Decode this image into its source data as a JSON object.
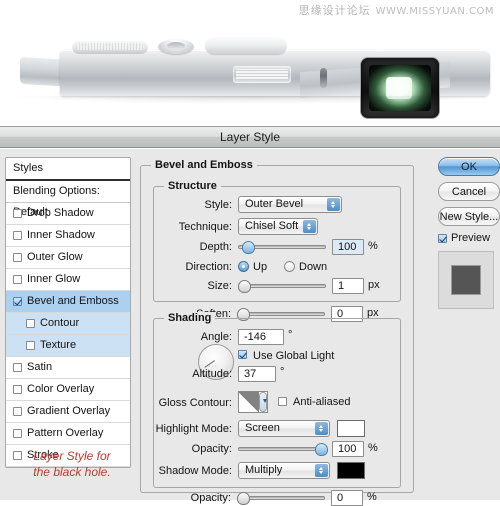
{
  "watermark": {
    "cn": "思缘设计论坛",
    "url": "WWW.MISSYUAN.COM"
  },
  "photo": {
    "alt": "silver compact camera side view with black lens window"
  },
  "dialog": {
    "title": "Layer Style"
  },
  "sidebar": {
    "header": "Styles",
    "blending_options": "Blending Options: Default",
    "items": [
      {
        "label": "Drop Shadow",
        "checked": false,
        "selected": false,
        "sub": false
      },
      {
        "label": "Inner Shadow",
        "checked": false,
        "selected": false,
        "sub": false
      },
      {
        "label": "Outer Glow",
        "checked": false,
        "selected": false,
        "sub": false
      },
      {
        "label": "Inner Glow",
        "checked": false,
        "selected": false,
        "sub": false
      },
      {
        "label": "Bevel and Emboss",
        "checked": true,
        "selected": true,
        "sub": false
      },
      {
        "label": "Contour",
        "checked": false,
        "selected": false,
        "sub": true
      },
      {
        "label": "Texture",
        "checked": false,
        "selected": false,
        "sub": true
      },
      {
        "label": "Satin",
        "checked": false,
        "selected": false,
        "sub": false
      },
      {
        "label": "Color Overlay",
        "checked": false,
        "selected": false,
        "sub": false
      },
      {
        "label": "Gradient Overlay",
        "checked": false,
        "selected": false,
        "sub": false
      },
      {
        "label": "Pattern Overlay",
        "checked": false,
        "selected": false,
        "sub": false
      },
      {
        "label": "Stroke",
        "checked": false,
        "selected": false,
        "sub": false
      }
    ]
  },
  "annotation": {
    "line1": "Layer Style for",
    "line2": "the black hole.",
    "color": "#c0392b"
  },
  "main": {
    "group_title": "Bevel and Emboss",
    "structure": {
      "title": "Structure",
      "style_label": "Style:",
      "style_value": "Outer Bevel",
      "technique_label": "Technique:",
      "technique_value": "Chisel Soft",
      "depth_label": "Depth:",
      "depth_value": "100",
      "depth_unit": "%",
      "direction_label": "Direction:",
      "direction_up": "Up",
      "direction_down": "Down",
      "direction_selected": "Up",
      "size_label": "Size:",
      "size_value": "1",
      "size_unit": "px",
      "soften_label": "Soften:",
      "soften_value": "0",
      "soften_unit": "px"
    },
    "shading": {
      "title": "Shading",
      "angle_label": "Angle:",
      "angle_value": "-146",
      "angle_unit": "°",
      "use_global_light": "Use Global Light",
      "use_global_light_checked": true,
      "altitude_label": "Altitude:",
      "altitude_value": "37",
      "altitude_unit": "°",
      "gloss_contour_label": "Gloss Contour:",
      "anti_aliased": "Anti-aliased",
      "anti_aliased_checked": false,
      "highlight_mode_label": "Highlight Mode:",
      "highlight_mode_value": "Screen",
      "highlight_color": "#ffffff",
      "highlight_opacity_label": "Opacity:",
      "highlight_opacity_value": "100",
      "highlight_opacity_unit": "%",
      "shadow_mode_label": "Shadow Mode:",
      "shadow_mode_value": "Multiply",
      "shadow_color": "#000000",
      "shadow_opacity_label": "Opacity:",
      "shadow_opacity_value": "0",
      "shadow_opacity_unit": "%"
    }
  },
  "buttons": {
    "ok": "OK",
    "cancel": "Cancel",
    "new_style": "New Style...",
    "preview": "Preview",
    "preview_checked": true,
    "preview_swatch_color": "#555555"
  }
}
